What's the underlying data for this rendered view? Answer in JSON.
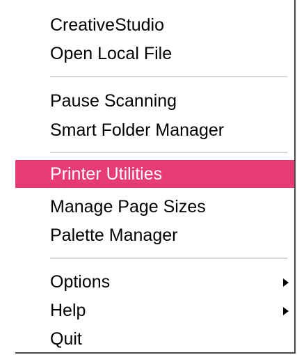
{
  "menu": {
    "items": [
      {
        "label": "CreativeStudio"
      },
      {
        "label": "Open Local File"
      },
      {
        "label": "Pause Scanning"
      },
      {
        "label": "Smart Folder Manager"
      },
      {
        "label": "Printer Utilities",
        "highlighted": true
      },
      {
        "label": "Manage Page Sizes"
      },
      {
        "label": "Palette Manager"
      },
      {
        "label": "Options",
        "submenu": true
      },
      {
        "label": "Help",
        "submenu": true
      },
      {
        "label": "Quit"
      }
    ]
  },
  "colors": {
    "highlight": "#e63b73",
    "highlight_text": "#ffffff",
    "separator": "#d6d6d6",
    "frame": "#4a4a4a"
  },
  "icons": {
    "submenu": "submenu-arrow-icon"
  }
}
